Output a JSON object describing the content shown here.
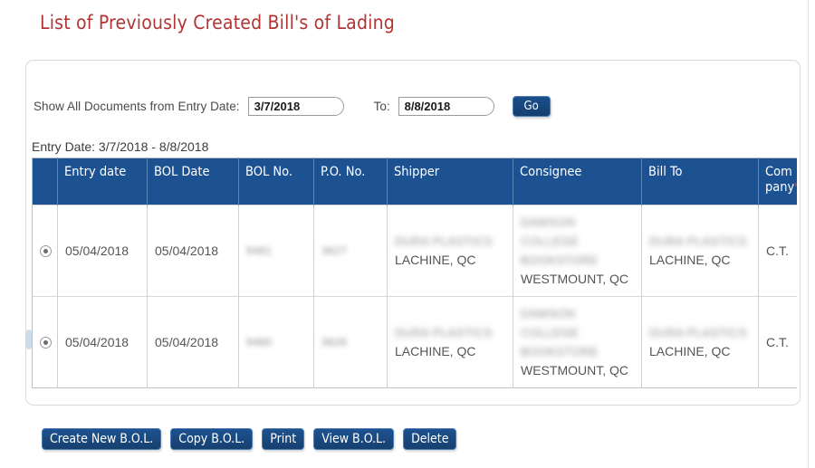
{
  "page": {
    "title": "List of Previously Created Bill's of Lading"
  },
  "filter": {
    "label": "Show All Documents from Entry Date:",
    "from_value": "3/7/2018",
    "from_placeholder": "",
    "to_label": "To:",
    "to_value": "8/8/2018",
    "to_placeholder": "",
    "go_label": "Go"
  },
  "summary": {
    "entry_date_range": "Entry Date: 3/7/2018 - 8/8/2018"
  },
  "table": {
    "columns": [
      {
        "key": "pick",
        "label": ""
      },
      {
        "key": "entry_date",
        "label": "Entry date"
      },
      {
        "key": "bol_date",
        "label": "BOL Date"
      },
      {
        "key": "bol_no",
        "label": "BOL No."
      },
      {
        "key": "po_no",
        "label": "P.O. No."
      },
      {
        "key": "shipper",
        "label": "Shipper"
      },
      {
        "key": "consignee",
        "label": "Consignee"
      },
      {
        "key": "bill_to",
        "label": "Bill To"
      },
      {
        "key": "company",
        "label": "Com pany",
        "required": true,
        "required_marker": "*"
      }
    ],
    "rows": [
      {
        "selected": true,
        "entry_date": "05/04/2018",
        "bol_date": "05/04/2018",
        "bol_no_redacted": "9481",
        "po_no_redacted": "3627",
        "shipper_redacted": "DURA PLASTICS",
        "shipper_city": "LACHINE, QC",
        "consignee_redacted": [
          "DAWSON",
          "COLLEGE",
          "BOOKSTORE"
        ],
        "consignee_city": "WESTMOUNT, QC",
        "bill_to_redacted": "DURA PLASTICS",
        "bill_to_city": "LACHINE, QC",
        "company": "C.T."
      },
      {
        "selected": true,
        "entry_date": "05/04/2018",
        "bol_date": "05/04/2018",
        "bol_no_redacted": "9480",
        "po_no_redacted": "3626",
        "shipper_redacted": "DURA PLASTICS",
        "shipper_city": "LACHINE, QC",
        "consignee_redacted": [
          "DAWSON",
          "COLLEGE",
          "BOOKSTORE"
        ],
        "consignee_city": "WESTMOUNT, QC",
        "bill_to_redacted": "DURA PLASTICS",
        "bill_to_city": "LACHINE, QC",
        "company": "C.T."
      }
    ]
  },
  "actions": {
    "create": "Create New B.O.L.",
    "copy": "Copy B.O.L.",
    "print": "Print",
    "view": "View B.O.L.",
    "delete": "Delete"
  },
  "colors": {
    "title": "#b33434",
    "header_blue": "#1c5292",
    "button_blue": "#1a4f8a",
    "required_star": "#e04a4a"
  }
}
